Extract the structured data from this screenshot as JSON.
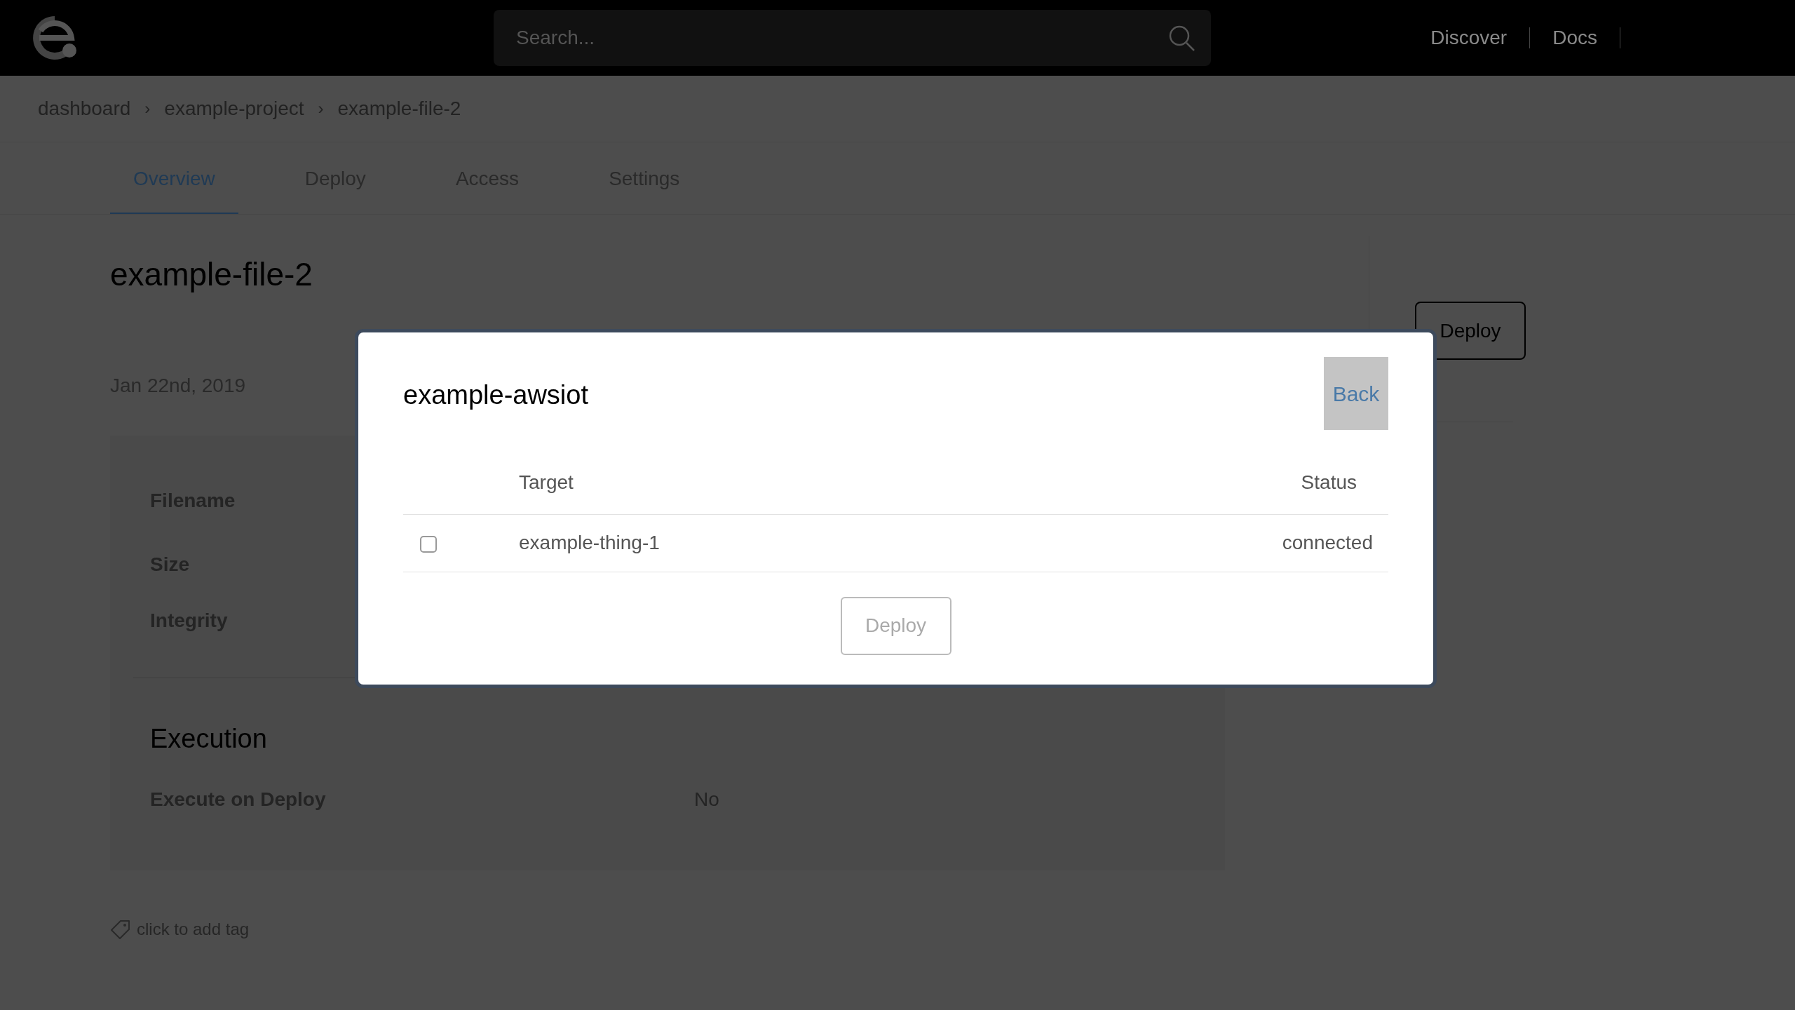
{
  "header": {
    "search": {
      "placeholder": "Search..."
    },
    "nav": [
      "Discover",
      "Docs"
    ]
  },
  "breadcrumb": {
    "items": [
      "dashboard",
      "example-project",
      "example-file-2"
    ],
    "separator": "›"
  },
  "tabs": [
    {
      "label": "Overview",
      "selected": true
    },
    {
      "label": "Deploy",
      "selected": false
    },
    {
      "label": "Access",
      "selected": false
    },
    {
      "label": "Settings",
      "selected": false
    }
  ],
  "file": {
    "title": "example-file-2",
    "date": "Jan 22nd, 2019",
    "fields": [
      "Filename",
      "Size",
      "Integrity"
    ],
    "execution": {
      "heading": "Execution",
      "rows": [
        {
          "label": "Execute on Deploy",
          "value": "No"
        }
      ]
    },
    "tag_hint": "click to add tag"
  },
  "deploy_button": "Deploy",
  "modal": {
    "title": "example-awsiot",
    "back": "Back",
    "columns": [
      "Target",
      "Status"
    ],
    "rows": [
      {
        "target": "example-thing-1",
        "status": "connected",
        "checked": false
      }
    ],
    "deploy": {
      "label": "Deploy",
      "disabled": true
    }
  }
}
